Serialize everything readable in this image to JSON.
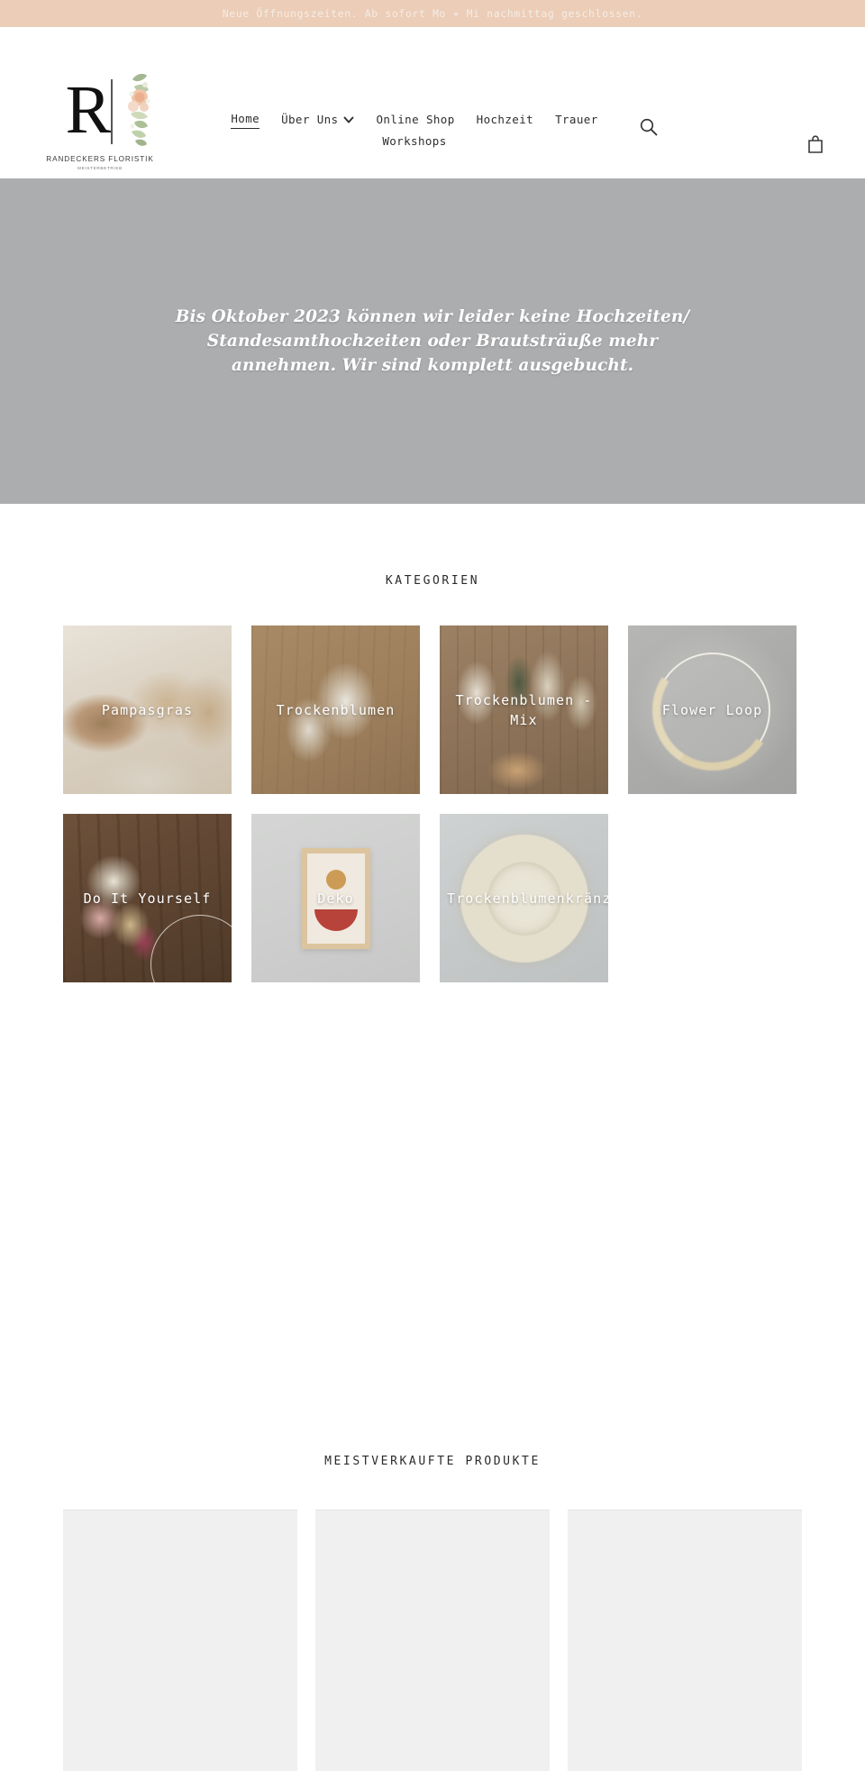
{
  "announcement": {
    "text": "Neue Öffnungszeiten. Ab sofort Mo + Mi nachmittag geschlossen.",
    "background": "#eccdb7",
    "text_color": "#f4ede7"
  },
  "header": {
    "logo": {
      "letter": "R",
      "name": "RANDECKERS FLORISTIK",
      "subtitle": "MEISTERBETRIEB"
    },
    "nav": [
      {
        "label": "Home",
        "active": true,
        "has_dropdown": false
      },
      {
        "label": "Über Uns",
        "active": false,
        "has_dropdown": true
      },
      {
        "label": "Online Shop",
        "active": false,
        "has_dropdown": false
      },
      {
        "label": "Hochzeit",
        "active": false,
        "has_dropdown": false
      },
      {
        "label": "Trauer",
        "active": false,
        "has_dropdown": false
      },
      {
        "label": "Workshops",
        "active": false,
        "has_dropdown": false
      }
    ],
    "search_icon": "search-icon",
    "cart_icon": "shopping-bag-icon"
  },
  "hero": {
    "background": "#acadaf",
    "text": "Bis Oktober 2023 können wir leider keine Hochzeiten/ Standesamthochzeiten oder Brautsträuße mehr annehmen. Wir sind komplett ausgebucht."
  },
  "categories": {
    "title": "KATEGORIEN",
    "tiles": [
      {
        "label": "Pampasgras",
        "art": "art-pampas"
      },
      {
        "label": "Trockenblumen",
        "art": "art-trocken"
      },
      {
        "label": "Trockenblumen - Mix",
        "art": "art-mix"
      },
      {
        "label": "Flower Loop",
        "art": "art-loop"
      },
      {
        "label": "Do It Yourself",
        "art": "art-diy"
      },
      {
        "label": "Deko",
        "art": "art-deko"
      },
      {
        "label": "Trockenblumenkränze",
        "art": "art-kranz"
      }
    ]
  },
  "bestsellers": {
    "title": "MEISTVERKAUFTE PRODUKTE",
    "cards": [
      {
        "label": ""
      },
      {
        "label": ""
      },
      {
        "label": ""
      }
    ]
  }
}
